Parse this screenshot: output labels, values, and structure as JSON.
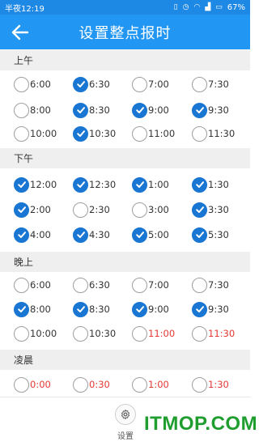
{
  "status_bar": {
    "time": "半夜12:19",
    "battery": "67%"
  },
  "app_bar": {
    "title": "设置整点报时"
  },
  "sections": [
    {
      "name": "上午",
      "items": [
        {
          "time": "6:00",
          "checked": false,
          "red": false
        },
        {
          "time": "6:30",
          "checked": true,
          "red": false
        },
        {
          "time": "7:00",
          "checked": false,
          "red": false
        },
        {
          "time": "7:30",
          "checked": false,
          "red": false
        },
        {
          "time": "8:00",
          "checked": false,
          "red": false
        },
        {
          "time": "8:30",
          "checked": true,
          "red": false
        },
        {
          "time": "9:00",
          "checked": true,
          "red": false
        },
        {
          "time": "9:30",
          "checked": true,
          "red": false
        },
        {
          "time": "10:00",
          "checked": false,
          "red": false
        },
        {
          "time": "10:30",
          "checked": true,
          "red": false
        },
        {
          "time": "11:00",
          "checked": false,
          "red": false
        },
        {
          "time": "11:30",
          "checked": false,
          "red": false
        }
      ]
    },
    {
      "name": "下午",
      "items": [
        {
          "time": "12:00",
          "checked": true,
          "red": false
        },
        {
          "time": "12:30",
          "checked": true,
          "red": false
        },
        {
          "time": "1:00",
          "checked": true,
          "red": false
        },
        {
          "time": "1:30",
          "checked": true,
          "red": false
        },
        {
          "time": "2:00",
          "checked": true,
          "red": false
        },
        {
          "time": "2:30",
          "checked": false,
          "red": false
        },
        {
          "time": "3:00",
          "checked": false,
          "red": false
        },
        {
          "time": "3:30",
          "checked": true,
          "red": false
        },
        {
          "time": "4:00",
          "checked": true,
          "red": false
        },
        {
          "time": "4:30",
          "checked": true,
          "red": false
        },
        {
          "time": "5:00",
          "checked": true,
          "red": false
        },
        {
          "time": "5:30",
          "checked": true,
          "red": false
        }
      ]
    },
    {
      "name": "晚上",
      "items": [
        {
          "time": "6:00",
          "checked": false,
          "red": false
        },
        {
          "time": "6:30",
          "checked": false,
          "red": false
        },
        {
          "time": "7:00",
          "checked": false,
          "red": false
        },
        {
          "time": "7:30",
          "checked": false,
          "red": false
        },
        {
          "time": "8:00",
          "checked": true,
          "red": false
        },
        {
          "time": "8:30",
          "checked": true,
          "red": false
        },
        {
          "time": "9:00",
          "checked": true,
          "red": false
        },
        {
          "time": "9:30",
          "checked": true,
          "red": false
        },
        {
          "time": "10:00",
          "checked": false,
          "red": false
        },
        {
          "time": "10:30",
          "checked": false,
          "red": false
        },
        {
          "time": "11:00",
          "checked": false,
          "red": true
        },
        {
          "time": "11:30",
          "checked": false,
          "red": true
        }
      ]
    },
    {
      "name": "凌晨",
      "items": [
        {
          "time": "0:00",
          "checked": false,
          "red": true
        },
        {
          "time": "0:30",
          "checked": false,
          "red": true
        },
        {
          "time": "1:00",
          "checked": false,
          "red": true
        },
        {
          "time": "1:30",
          "checked": false,
          "red": true
        }
      ]
    }
  ],
  "bottom": {
    "settings_label": "设置"
  },
  "watermark": "ITMOP.COM",
  "colors": {
    "accent": "#2196f3",
    "checked": "#1976d2",
    "red_text": "#e53935",
    "watermark": "#1f9e2f"
  }
}
